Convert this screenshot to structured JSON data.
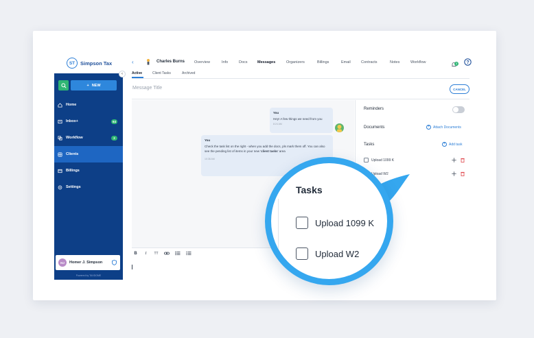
{
  "brand": {
    "logo_initials": "ST",
    "name": "Simpson Tax",
    "powered_by": "Powered by TAXDOME"
  },
  "sidebar": {
    "new_label": "NEW",
    "items": [
      {
        "label": "Home",
        "icon": "home-icon",
        "count": ""
      },
      {
        "label": "Inbox+",
        "icon": "inbox-icon",
        "count": "64"
      },
      {
        "label": "Workflow",
        "icon": "workflow-icon",
        "count": "2"
      },
      {
        "label": "Clients",
        "icon": "clients-icon",
        "count": ""
      },
      {
        "label": "Billings",
        "icon": "billings-icon",
        "count": ""
      },
      {
        "label": "Settings",
        "icon": "settings-icon",
        "count": ""
      }
    ],
    "active_item": "Clients",
    "user": {
      "initials": "HJ",
      "name": "Homer J. Simpson"
    }
  },
  "header": {
    "client_name": "Charles Burns",
    "tabs": [
      "Overview",
      "Info",
      "Docs",
      "Messages",
      "Organizers",
      "Billings",
      "Email",
      "Contracts",
      "Notes",
      "Workflow"
    ],
    "active_tab": "Messages",
    "sub_tabs": [
      "Active",
      "Client Tasks",
      "Archived"
    ],
    "active_sub_tab": "Active",
    "notification_count": "3"
  },
  "composer": {
    "title_placeholder": "Message Title",
    "cancel_label": "CANCEL"
  },
  "messages": [
    {
      "author": "You",
      "text": "Hey! A few things we need from you",
      "time": "8:24 AM"
    },
    {
      "author": "You",
      "text_before": "Check the task list on the right - when you add the docs, pls mark them off. You can also see the pending list of items in your new '",
      "text_bold": "client tasks",
      "text_after": "' area",
      "time": "10:38 AM"
    }
  ],
  "editor": {
    "toolbar": [
      "B",
      "I",
      "T",
      "link",
      "bullet-list",
      "numbered-list"
    ]
  },
  "right_panel": {
    "reminders_label": "Reminders",
    "reminders_on": false,
    "documents_label": "Documents",
    "attach_label": "Attach Documents",
    "tasks_label": "Tasks",
    "add_task_label": "Add task",
    "tasks": [
      "Upload 1099 K",
      "Upload W2"
    ]
  },
  "magnifier": {
    "title": "Tasks",
    "tasks": [
      "Upload 1099 K",
      "Upload W2"
    ]
  },
  "colors": {
    "sidebar": "#0d3f87",
    "active_nav": "#1e66c2",
    "accent": "#2c7ed6",
    "green": "#2fb574",
    "magnifier_ring": "#35a7ef"
  }
}
